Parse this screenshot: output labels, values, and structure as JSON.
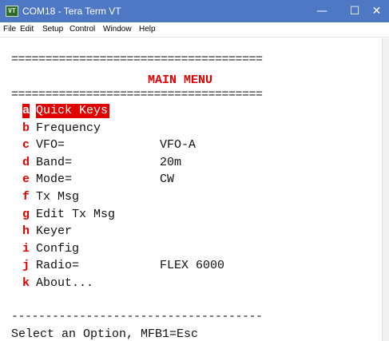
{
  "window": {
    "title": "COM18 - Tera Term VT",
    "icon_label": "VT",
    "minimize_glyph": "—",
    "maximize_glyph": "☐",
    "close_glyph": "✕"
  },
  "menubar": {
    "items": [
      "File",
      "Edit",
      "Setup",
      "Control",
      "Window",
      "Help"
    ]
  },
  "terminal": {
    "separator_top": "=====================================",
    "heading": "MAIN MENU",
    "separator_mid": "=====================================",
    "options": [
      {
        "key": "a",
        "label": "Quick Keys",
        "value": "",
        "selected": true
      },
      {
        "key": "b",
        "label": "Frequency",
        "value": "",
        "selected": false
      },
      {
        "key": "c",
        "label": "VFO=",
        "value": "VFO-A",
        "selected": false
      },
      {
        "key": "d",
        "label": "Band=",
        "value": "20m",
        "selected": false
      },
      {
        "key": "e",
        "label": "Mode=",
        "value": "CW",
        "selected": false
      },
      {
        "key": "f",
        "label": "Tx Msg",
        "value": "",
        "selected": false
      },
      {
        "key": "g",
        "label": "Edit Tx Msg",
        "value": "",
        "selected": false
      },
      {
        "key": "h",
        "label": "Keyer",
        "value": "",
        "selected": false
      },
      {
        "key": "i",
        "label": "Config",
        "value": "",
        "selected": false
      },
      {
        "key": "j",
        "label": "Radio=",
        "value": "FLEX 6000",
        "selected": false
      },
      {
        "key": "k",
        "label": "About...",
        "value": "",
        "selected": false
      }
    ],
    "separator_bottom": "-------------------------------------",
    "prompt": "Select an Option, MFB1=Esc"
  },
  "colors": {
    "titlebar": "#4f78c4",
    "accent_red": "#e00000",
    "background": "#ffffff"
  }
}
